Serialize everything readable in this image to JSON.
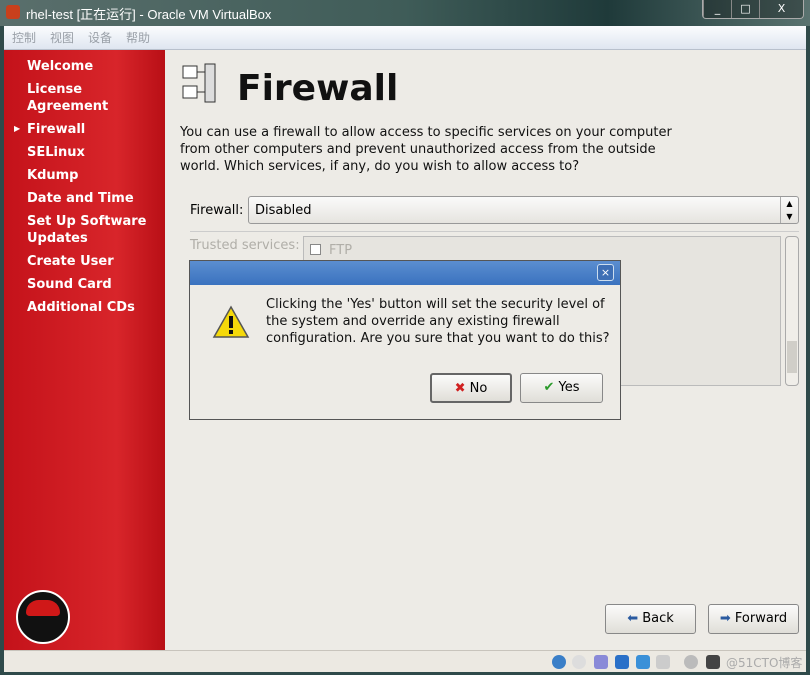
{
  "window": {
    "title": "rhel-test [正在运行] - Oracle VM VirtualBox",
    "minimize": "_",
    "maximize": "□",
    "close": "X"
  },
  "menu": [
    "控制",
    "视图",
    "设备",
    "帮助"
  ],
  "sidebar": {
    "items": [
      "Welcome",
      "License Agreement",
      "Firewall",
      "SELinux",
      "Kdump",
      "Date and Time",
      "Set Up Software Updates",
      "Create User",
      "Sound Card",
      "Additional CDs"
    ],
    "active": "Firewall"
  },
  "main": {
    "title": "Firewall",
    "description": "You can use a firewall to allow access to specific services on your computer from other computers and prevent unauthorized access from the outside world.  Which services, if any, do you wish to allow access to?",
    "firewall_label": "Firewall:",
    "firewall_value": "Disabled",
    "trusted_label": "Trusted services:",
    "services": [
      {
        "label": "FTP",
        "checked": false
      }
    ]
  },
  "dialog": {
    "message": "Clicking the 'Yes' button will set the security level of the system and override any existing firewall configuration.  Are you sure that you want to do this?",
    "no": "No",
    "yes": "Yes",
    "close": "×"
  },
  "nav": {
    "back": "Back",
    "forward": "Forward"
  },
  "watermark": "@51CTO博客",
  "colors": {
    "sidebar": "#c4121a",
    "dialog_title": "#3a72bf"
  }
}
